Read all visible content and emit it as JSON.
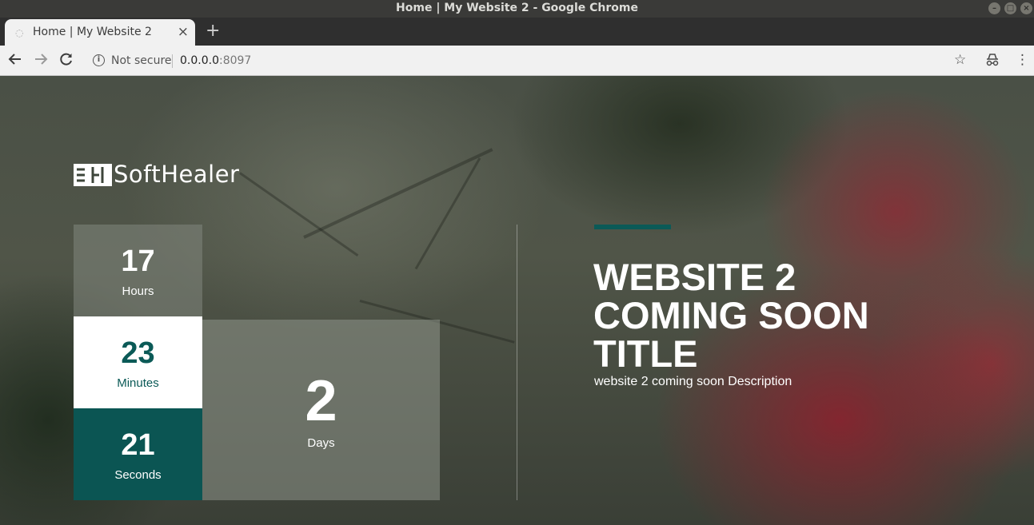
{
  "window": {
    "title": "Home | My Website 2 - Google Chrome"
  },
  "tabs": [
    {
      "title": "Home | My Website 2"
    }
  ],
  "address_bar": {
    "security_label": "Not secure",
    "url_host": "0.0.0.0",
    "url_port": ":8097"
  },
  "page": {
    "logo_text": "SoftHealer",
    "countdown": {
      "hours": {
        "value": "17",
        "label": "Hours"
      },
      "minutes": {
        "value": "23",
        "label": "Minutes"
      },
      "seconds": {
        "value": "21",
        "label": "Seconds"
      },
      "days": {
        "value": "2",
        "label": "Days"
      }
    },
    "headline": "WEBSITE 2 COMING SOON TITLE",
    "description": "website 2 coming soon Description"
  },
  "colors": {
    "accent": "#0b5a57",
    "minutes_bg": "#ffffff",
    "seconds_bg": "#0b5553"
  },
  "icons": [
    "back-arrow-icon",
    "forward-arrow-icon",
    "reload-icon",
    "info-icon",
    "star-icon",
    "incognito-icon",
    "menu-kebab-icon",
    "new-tab-plus-icon",
    "tab-close-icon"
  ]
}
